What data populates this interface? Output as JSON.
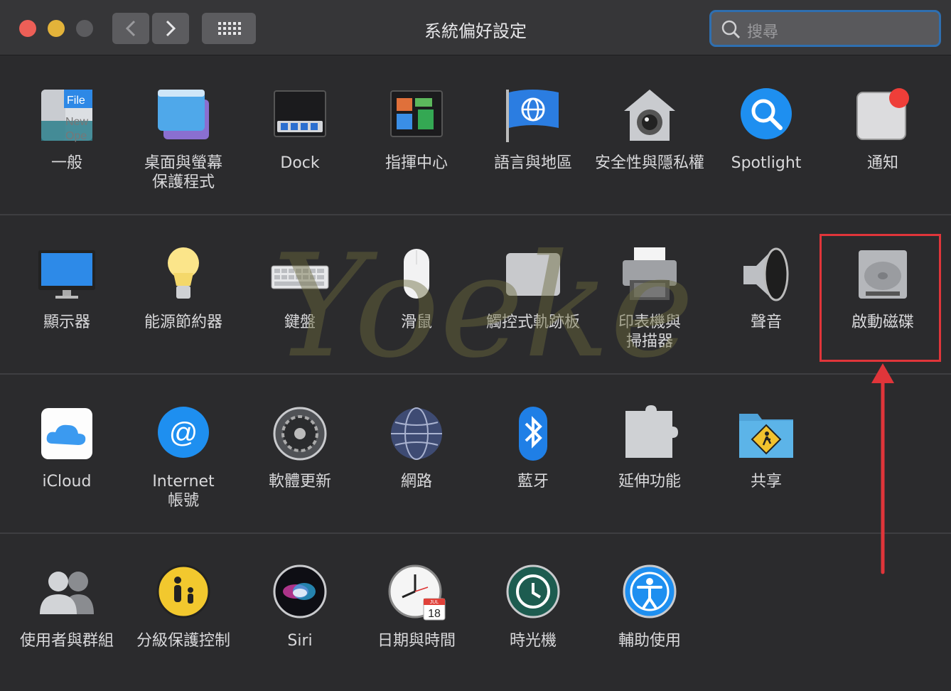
{
  "window": {
    "title": "系統偏好設定"
  },
  "toolbar": {
    "search_placeholder": "搜尋"
  },
  "rows": [
    [
      {
        "label": "一般",
        "icon": "general-icon"
      },
      {
        "label": "桌面與螢幕\n保護程式",
        "icon": "desktop-screensaver-icon"
      },
      {
        "label": "Dock",
        "icon": "dock-icon"
      },
      {
        "label": "指揮中心",
        "icon": "mission-control-icon"
      },
      {
        "label": "語言與地區",
        "icon": "language-region-icon"
      },
      {
        "label": "安全性與隱私權",
        "icon": "security-privacy-icon"
      },
      {
        "label": "Spotlight",
        "icon": "spotlight-icon"
      },
      {
        "label": "通知",
        "icon": "notifications-icon"
      }
    ],
    [
      {
        "label": "顯示器",
        "icon": "displays-icon"
      },
      {
        "label": "能源節約器",
        "icon": "energy-saver-icon"
      },
      {
        "label": "鍵盤",
        "icon": "keyboard-icon"
      },
      {
        "label": "滑鼠",
        "icon": "mouse-icon"
      },
      {
        "label": "觸控式軌跡板",
        "icon": "trackpad-icon"
      },
      {
        "label": "印表機與\n掃描器",
        "icon": "printers-scanners-icon"
      },
      {
        "label": "聲音",
        "icon": "sound-icon"
      },
      {
        "label": "啟動磁碟",
        "icon": "startup-disk-icon"
      }
    ],
    [
      {
        "label": "iCloud",
        "icon": "icloud-icon"
      },
      {
        "label": "Internet\n帳號",
        "icon": "internet-accounts-icon"
      },
      {
        "label": "軟體更新",
        "icon": "software-update-icon"
      },
      {
        "label": "網路",
        "icon": "network-icon"
      },
      {
        "label": "藍牙",
        "icon": "bluetooth-icon"
      },
      {
        "label": "延伸功能",
        "icon": "extensions-icon"
      },
      {
        "label": "共享",
        "icon": "sharing-icon"
      }
    ],
    [
      {
        "label": "使用者與群組",
        "icon": "users-groups-icon"
      },
      {
        "label": "分級保護控制",
        "icon": "parental-controls-icon"
      },
      {
        "label": "Siri",
        "icon": "siri-icon"
      },
      {
        "label": "日期與時間",
        "icon": "date-time-icon"
      },
      {
        "label": "時光機",
        "icon": "time-machine-icon"
      },
      {
        "label": "輔助使用",
        "icon": "accessibility-icon"
      }
    ]
  ],
  "icon_texts": {
    "general_file": "File",
    "general_new": "New",
    "general_open": "Ope",
    "calendar_month": "JUL",
    "calendar_day": "18"
  },
  "watermark": {
    "text": "Yoeke"
  },
  "colors": {
    "highlight": "#e0353a",
    "search_focus": "#2f6fb0"
  }
}
